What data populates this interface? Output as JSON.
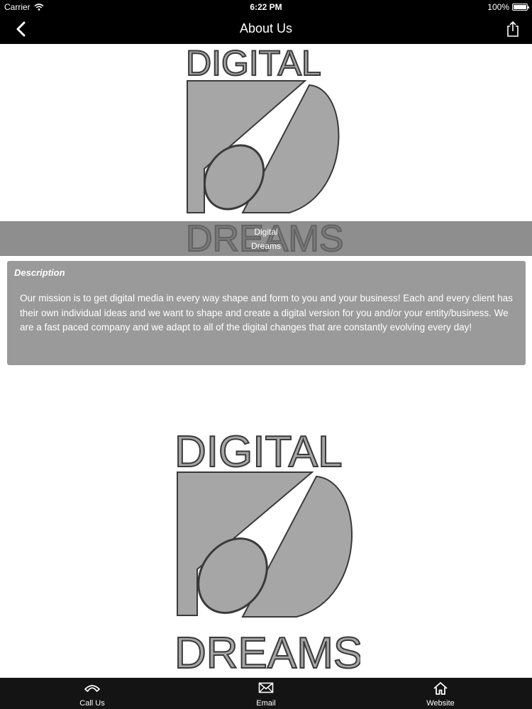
{
  "status_bar": {
    "carrier": "Carrier",
    "time": "6:22 PM",
    "battery": "100%",
    "icons": [
      "wifi-icon",
      "battery-icon"
    ]
  },
  "nav": {
    "title": "About Us",
    "icons": [
      "back-chevron-icon",
      "share-icon"
    ]
  },
  "logo": {
    "text_top": "DIGITAL",
    "text_bottom": "DREAMS",
    "colors": {
      "fill": "#a6a6a6",
      "outline": "#3c3c3c"
    }
  },
  "caption": {
    "line1": "Digital",
    "line2": "Dreams"
  },
  "description": {
    "heading": "Description",
    "body": "Our mission is to get digital media in every way shape and form to you and your business! Each and every client has their own individual ideas and we want to shape and create a digital version for you and/or your entity/business. We are a fast paced company and we adapt to all of the digital changes that are constantly evolving every day!"
  },
  "tab_bar": {
    "items": [
      {
        "label": "Call Us",
        "icon": "phone-icon"
      },
      {
        "label": "Email",
        "icon": "envelope-icon"
      },
      {
        "label": "Website",
        "icon": "home-icon"
      }
    ]
  },
  "colors": {
    "bar_background": "#000000",
    "card_background": "#9a9a9a",
    "tab_background": "#141414"
  }
}
